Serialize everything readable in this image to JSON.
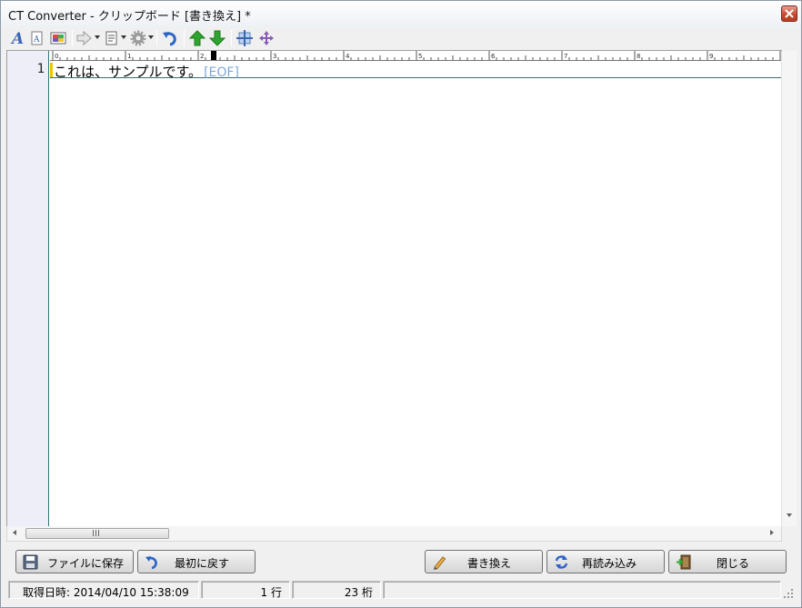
{
  "window": {
    "title": "CT Converter - クリップボード [書き換え] *"
  },
  "toolbar": {
    "icons": [
      "font-icon",
      "font-small-icon",
      "color-palette-icon",
      "export-icon",
      "document-icon",
      "settings-icon",
      "undo-icon",
      "arrow-up-icon",
      "arrow-down-icon",
      "expand-icon",
      "move-icon"
    ]
  },
  "editor": {
    "line_number": "1",
    "line_text": "これは、サンプルです。",
    "eof_marker": "[EOF]",
    "ruler_labels": [
      "0",
      "1",
      "2",
      "3",
      "4",
      "5",
      "6",
      "7",
      "8",
      "9"
    ]
  },
  "buttons": {
    "save_to_file": "ファイルに保存",
    "revert": "最初に戻す",
    "rewrite": "書き換え",
    "reload": "再読み込み",
    "close": "閉じる"
  },
  "status": {
    "acquired_time": "取得日時: 2014/04/10 15:38:09",
    "line_count": "1 行",
    "column_count": "23 桁"
  },
  "colors": {
    "gutter_bg": "#eeeef8",
    "gutter_border": "#2c7a74",
    "eof": "#7fa8d4",
    "caret_mark": "#f2c400",
    "undo_blue": "#2b64c8",
    "arrow_green": "#2ea52e"
  }
}
